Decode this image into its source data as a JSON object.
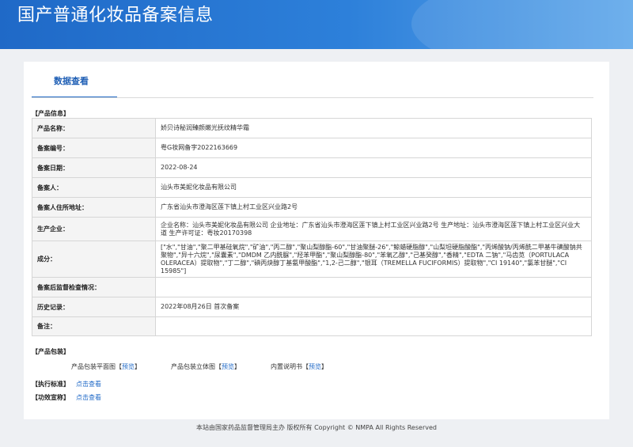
{
  "header": {
    "title": "国产普通化妆品备案信息"
  },
  "tabs": [
    {
      "label": "数据查看"
    }
  ],
  "product_section": {
    "label": "【产品信息】",
    "rows": [
      {
        "key": "产品名称：",
        "value": "娇贝诗秘润臻颜嫩光抚纹精华霜"
      },
      {
        "key": "备案编号：",
        "value": "粤G妆网备字2022163669"
      },
      {
        "key": "备案日期：",
        "value": "2022-08-24"
      },
      {
        "key": "备案人：",
        "value": "汕头市美妮化妆品有限公司"
      },
      {
        "key": "备案人住所地址：",
        "value": "广东省汕头市澄海区莲下镇上村工业区兴业路2号"
      },
      {
        "key": "生产企业：",
        "value": "企业名称：汕头市美妮化妆品有限公司 企业地址：广东省汕头市澄海区莲下镇上村工业区兴业路2号 生产地址：汕头市澄海区莲下镇上村工业区兴业大道 生产许可证：粤妆20170398"
      },
      {
        "key": "成分：",
        "value": "[\"水\",\"甘油\",\"聚二甲基硅氧烷\",\"矿油\",\"丙二醇\",\"聚山梨醇酯-60\",\"甘油聚醚-26\",\"鲸蜡硬脂醇\",\"山梨坦硬脂酸酯\",\"丙烯酸钠/丙烯酰二甲基牛磺酸钠共聚物\",\"异十六烷\",\"尿囊素\",\"DMDM 乙内酰脲\",\"羟苯甲酯\",\"聚山梨醇酯-80\",\"苯氧乙醇\",\"己基癸醇\",\"香精\",\"EDTA 二钠\",\"马齿苋（PORTULACA OLERACEA）提取物\",\"丁二醇\",\"碘丙炔醇丁基氨甲酸酯\",\"1,2-己二醇\",\"银耳（TREMELLA FUCIFORMIS）提取物\",\"CI 19140\",\"氯苯甘醚\",\"CI 15985\"]"
      },
      {
        "key": "备案后监督检查情况：",
        "value": ""
      },
      {
        "key": "历史记录：",
        "value": "2022年08月26日 首次备案"
      },
      {
        "key": "备注：",
        "value": ""
      }
    ]
  },
  "packaging": {
    "label": "【产品包装】",
    "items": [
      {
        "name": "产品包装平面图",
        "link": "预览"
      },
      {
        "name": "产品包装立体图",
        "link": "预览"
      },
      {
        "name": "内置说明书",
        "link": "预览"
      }
    ]
  },
  "standards": {
    "label": "【执行标准】",
    "link": "点击查看"
  },
  "claims": {
    "label": "【功效宣称】",
    "link": "点击查看"
  },
  "footer": {
    "text": "本站由国家药品监督管理局主办 版权所有 Copyright © NMPA All Rights Reserved"
  }
}
